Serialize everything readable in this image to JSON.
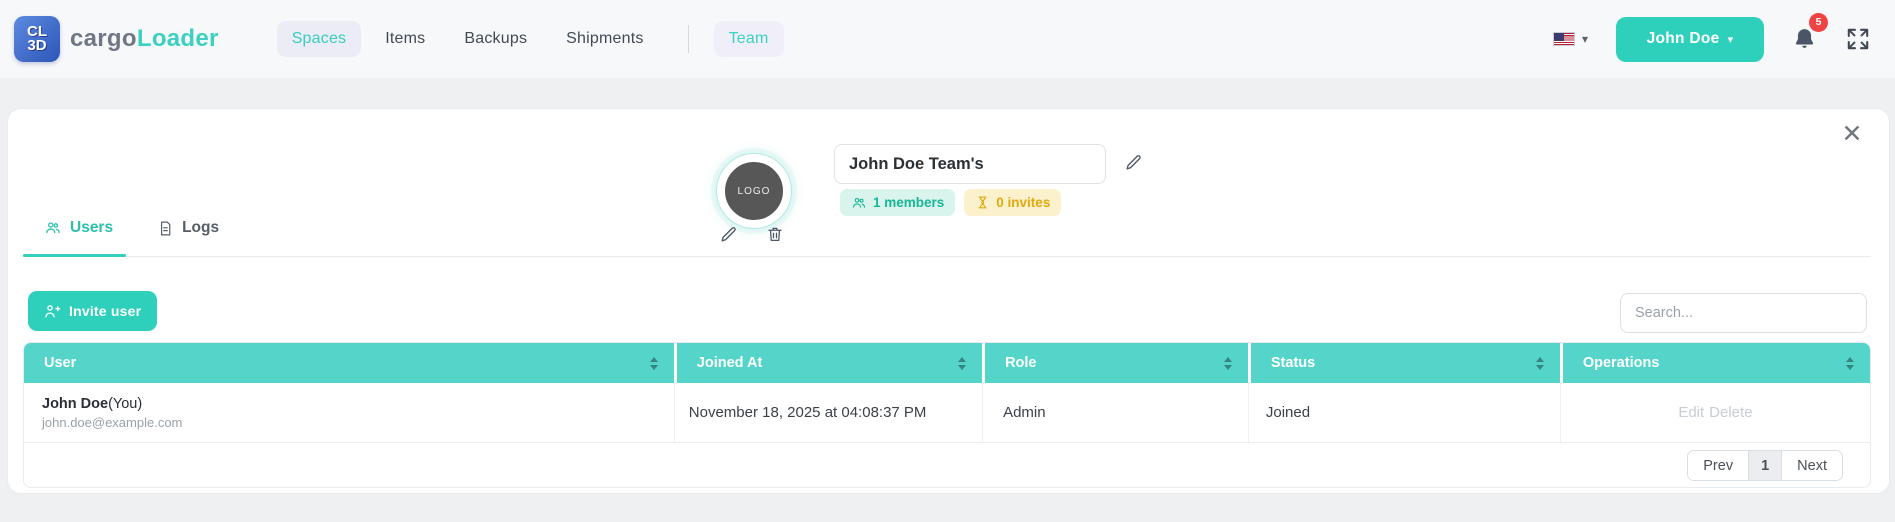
{
  "header": {
    "logo": {
      "top": "CL",
      "bottom": "3D"
    },
    "brand": {
      "gray": "cargo",
      "teal": "Loader"
    },
    "nav": [
      {
        "label": "Spaces",
        "active": true
      },
      {
        "label": "Items",
        "active": false
      },
      {
        "label": "Backups",
        "active": false
      },
      {
        "label": "Shipments",
        "active": false
      }
    ],
    "team_tab": "Team",
    "user_button": "John Doe",
    "notification_count": "5"
  },
  "team": {
    "avatar_label": "LOGO",
    "name": "John Doe Team's",
    "members_badge": "1 members",
    "invites_badge": "0 invites"
  },
  "tabs": {
    "users": "Users",
    "logs": "Logs"
  },
  "toolbar": {
    "invite": "Invite user",
    "search_placeholder": "Search..."
  },
  "table": {
    "columns": [
      "User",
      "Joined At",
      "Role",
      "Status",
      "Operations"
    ],
    "rows": [
      {
        "name": "John Doe",
        "you": "(You)",
        "email": "john.doe@example.com",
        "joined_at": "November 18, 2025 at 04:08:37 PM",
        "role": "Admin",
        "status": "Joined",
        "ops": {
          "edit": "Edit",
          "delete": "Delete"
        }
      }
    ]
  },
  "pagination": {
    "prev": "Prev",
    "page": "1",
    "next": "Next"
  },
  "colors": {
    "accent_teal": "#2fd0bb",
    "table_header_teal": "#55d5ca",
    "badge_teal_text": "#19b597",
    "badge_yellow_text": "#dfa90e",
    "notification_red": "#ee4444"
  }
}
